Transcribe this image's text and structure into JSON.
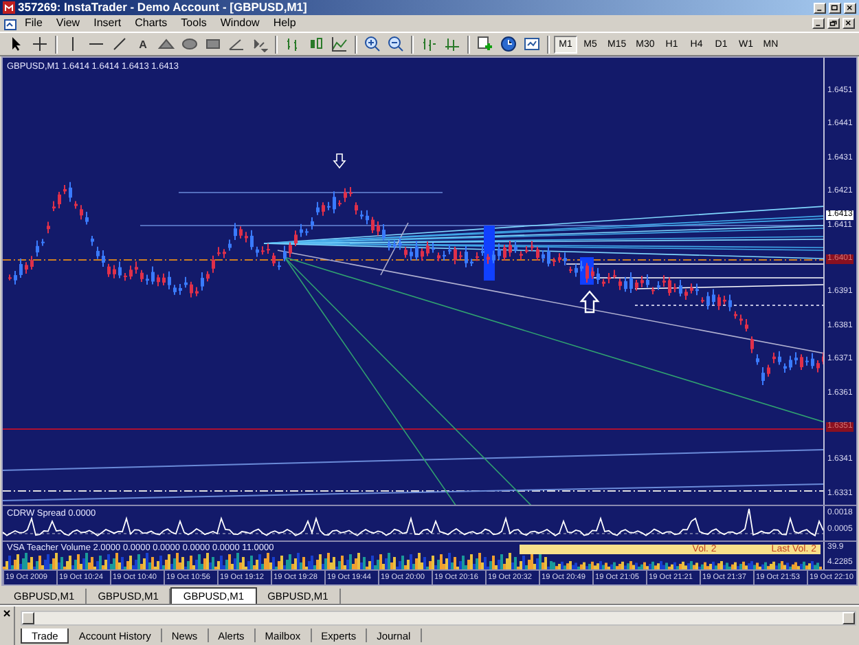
{
  "window": {
    "title": "357269: InstaTrader - Demo Account - [GBPUSD,M1]"
  },
  "menu": [
    "File",
    "View",
    "Insert",
    "Charts",
    "Tools",
    "Window",
    "Help"
  ],
  "toolbar": [
    {
      "kind": "cursor"
    },
    {
      "kind": "crosshair"
    },
    {
      "kind": "sep"
    },
    {
      "kind": "vline"
    },
    {
      "kind": "hline"
    },
    {
      "kind": "trendline"
    },
    {
      "kind": "glyph",
      "text": "A"
    },
    {
      "kind": "triangle"
    },
    {
      "kind": "ellipse"
    },
    {
      "kind": "rectangle"
    },
    {
      "kind": "angle"
    },
    {
      "kind": "arrows"
    },
    {
      "kind": "sep"
    },
    {
      "kind": "bars"
    },
    {
      "kind": "candles"
    },
    {
      "kind": "line"
    },
    {
      "kind": "sep"
    },
    {
      "kind": "zoomin"
    },
    {
      "kind": "zoomout"
    },
    {
      "kind": "sep"
    },
    {
      "kind": "scroll"
    },
    {
      "kind": "shift"
    },
    {
      "kind": "sep"
    },
    {
      "kind": "indicators"
    },
    {
      "kind": "clock"
    },
    {
      "kind": "templates"
    },
    {
      "kind": "sep"
    }
  ],
  "timeframes": [
    {
      "label": "M1",
      "selected": true
    },
    {
      "label": "M5",
      "selected": false
    },
    {
      "label": "M15",
      "selected": false
    },
    {
      "label": "M30",
      "selected": false
    },
    {
      "label": "H1",
      "selected": false
    },
    {
      "label": "H4",
      "selected": false
    },
    {
      "label": "D1",
      "selected": false
    },
    {
      "label": "W1",
      "selected": false
    },
    {
      "label": "MN",
      "selected": false
    }
  ],
  "chart": {
    "header": "GBPUSD,M1  1.6414 1.6414 1.6413 1.6413",
    "price_axis": [
      "1.6451",
      "1.6441",
      "1.6431",
      "1.6421",
      "1.6411",
      "1.6391",
      "1.6381",
      "1.6371",
      "1.6361",
      "1.6341",
      "1.6331"
    ],
    "current_price": "1.6413",
    "level_labels": [
      "1.6401",
      "1.6351"
    ],
    "panes": [
      {
        "kind": "line",
        "title": "CDRW Spread 0.0000",
        "axis": [
          "0.0018",
          "0.0005"
        ]
      },
      {
        "kind": "volume",
        "title": "VSA Teacher Volume 2.0000 0.0000 0.0000 0.0000 0.0000 11.0000",
        "axis": [
          "39.9",
          "4.2285"
        ],
        "banner": {
          "left": "Vol. 2",
          "right": "Last Vol. 2"
        }
      }
    ],
    "time_axis": [
      "19 Oct 2009",
      "19 Oct 10:24",
      "19 Oct 10:40",
      "19 Oct 10:56",
      "19 Oct 19:12",
      "19 Oct 19:28",
      "19 Oct 19:44",
      "19 Oct 20:00",
      "19 Oct 20:16",
      "19 Oct 20:32",
      "19 Oct 20:49",
      "19 Oct 21:05",
      "19 Oct 21:21",
      "19 Oct 21:37",
      "19 Oct 21:53",
      "19 Oct 22:10"
    ]
  },
  "chart_tabs": [
    {
      "label": "GBPUSD,M1",
      "selected": false
    },
    {
      "label": "GBPUSD,M1",
      "selected": false
    },
    {
      "label": "GBPUSD,M1",
      "selected": true
    },
    {
      "label": "GBPUSD,M1",
      "selected": false
    }
  ],
  "terminal_tabs": [
    {
      "label": "Trade",
      "selected": true
    },
    {
      "label": "Account History",
      "selected": false
    },
    {
      "label": "News",
      "selected": false
    },
    {
      "label": "Alerts",
      "selected": false
    },
    {
      "label": "Mailbox",
      "selected": false
    },
    {
      "label": "Experts",
      "selected": false
    },
    {
      "label": "Journal",
      "selected": false
    }
  ]
}
